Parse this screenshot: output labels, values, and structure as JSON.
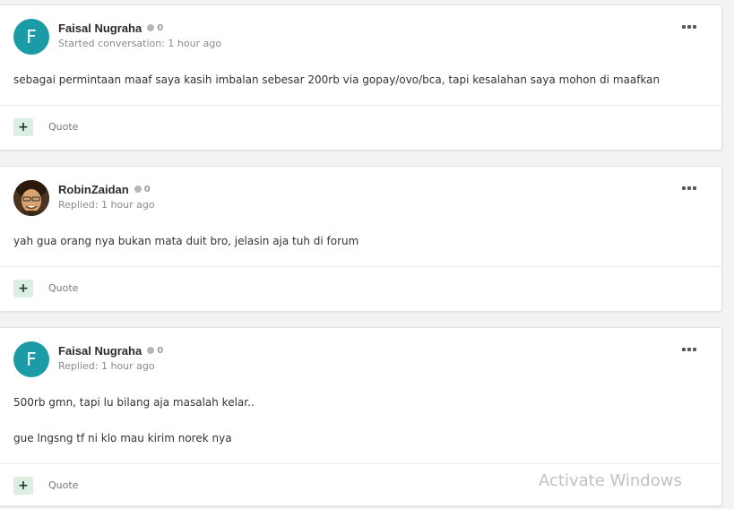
{
  "posts": [
    {
      "author": "Faisal Nugraha",
      "avatar_initial": "F",
      "avatar_type": "letter",
      "reputation": "0",
      "meta": "Started conversation: 1 hour ago",
      "body": [
        "sebagai permintaan maaf saya kasih imbalan sebesar 200rb via gopay/ovo/bca, tapi kesalahan saya mohon di maafkan"
      ],
      "quote_label": "Quote"
    },
    {
      "author": "RobinZaidan",
      "avatar_type": "photo",
      "reputation": "0",
      "meta": "Replied: 1 hour ago",
      "body": [
        "yah gua orang nya bukan mata duit bro, jelasin aja tuh di forum"
      ],
      "quote_label": "Quote"
    },
    {
      "author": "Faisal Nugraha",
      "avatar_initial": "F",
      "avatar_type": "letter",
      "reputation": "0",
      "meta": "Replied: 1 hour ago",
      "body": [
        "500rb gmn, tapi lu bilang aja masalah kelar..",
        "gue lngsng tf ni klo mau kirim norek nya"
      ],
      "quote_label": "Quote"
    }
  ],
  "watermark": "Activate Windows",
  "colors": {
    "avatar_teal": "#1a9ba6",
    "like_button_bg": "#dcefe0",
    "page_bg": "#f3f3f3"
  },
  "icons": {
    "more": "ellipsis-icon",
    "like": "plus-icon",
    "reputation": "reputation-dot-icon"
  }
}
